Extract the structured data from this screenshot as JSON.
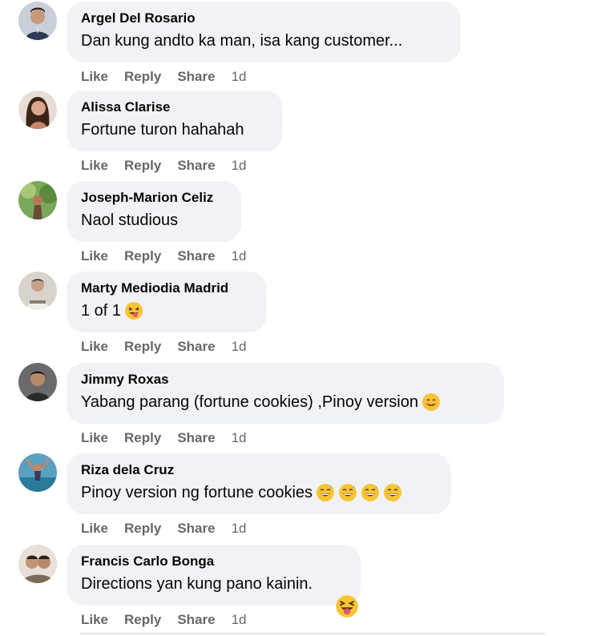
{
  "comments": [
    {
      "author": "Argel Del Rosario",
      "text": "Dan kung andto ka man, isa kang customer...",
      "emojis": [],
      "like": "Like",
      "reply": "Reply",
      "share": "Share",
      "time": "1d",
      "avatar_color": "#3a4a66"
    },
    {
      "author": "Alissa Clarise",
      "text": "Fortune turon hahahah",
      "emojis": [],
      "like": "Like",
      "reply": "Reply",
      "share": "Share",
      "time": "1d",
      "avatar_color": "#8a5a4a"
    },
    {
      "author": "Joseph-Marion Celiz",
      "text": "Naol studious",
      "emojis": [],
      "like": "Like",
      "reply": "Reply",
      "share": "Share",
      "time": "1d",
      "avatar_color": "#4e7a3a"
    },
    {
      "author": "Marty Mediodia Madrid",
      "text": "1 of 1",
      "emojis": [
        "grinning-tongue-emoji"
      ],
      "like": "Like",
      "reply": "Reply",
      "share": "Share",
      "time": "1d",
      "avatar_color": "#9a9080"
    },
    {
      "author": "Jimmy Roxas",
      "text": "Yabang parang (fortune cookies) ,Pinoy version",
      "emojis": [
        "smiling-emoji"
      ],
      "like": "Like",
      "reply": "Reply",
      "share": "Share",
      "time": "1d",
      "avatar_color": "#4a4040"
    },
    {
      "author": "Riza dela Cruz",
      "text": "Pinoy version ng fortune cookies",
      "emojis": [
        "sweat-smile-emoji",
        "sweat-smile-emoji",
        "sweat-smile-emoji",
        "sweat-smile-emoji"
      ],
      "like": "Like",
      "reply": "Reply",
      "share": "Share",
      "time": "1d",
      "avatar_color": "#3a7a9a"
    },
    {
      "author": "Francis Carlo Bonga",
      "text": "Directions yan kung pano kainin.",
      "emojis": [],
      "like": "Like",
      "reply": "Reply",
      "share": "Share",
      "time": "1d",
      "avatar_color": "#8a7a6a",
      "trailing_emoji": "squinting-tongue-emoji"
    }
  ],
  "colors": {
    "bubble": "#f0f2f5",
    "action_text": "#65676b",
    "name_text": "#050505"
  }
}
